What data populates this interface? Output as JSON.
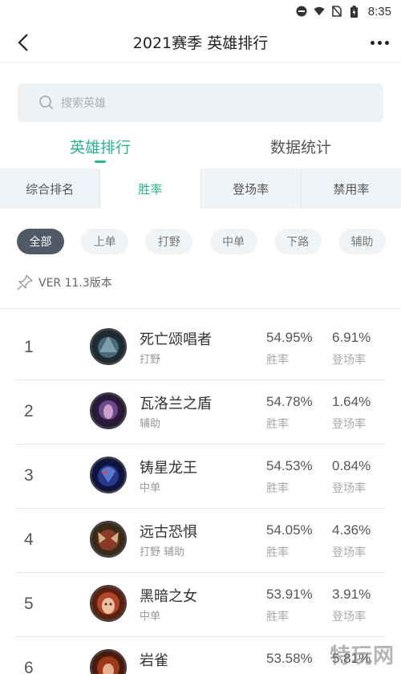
{
  "status_bar": {
    "time": "8:35"
  },
  "header": {
    "title": "2021赛季 英雄排行"
  },
  "search": {
    "placeholder": "搜索英雄"
  },
  "main_tabs": [
    {
      "label": "英雄排行",
      "active": true
    },
    {
      "label": "数据统计",
      "active": false
    }
  ],
  "sub_tabs": [
    {
      "label": "综合排名",
      "active": false
    },
    {
      "label": "胜率",
      "active": true
    },
    {
      "label": "登场率",
      "active": false
    },
    {
      "label": "禁用率",
      "active": false
    }
  ],
  "position_filters": [
    {
      "label": "全部",
      "active": true
    },
    {
      "label": "上单",
      "active": false
    },
    {
      "label": "打野",
      "active": false
    },
    {
      "label": "中单",
      "active": false
    },
    {
      "label": "下路",
      "active": false
    },
    {
      "label": "辅助",
      "active": false
    }
  ],
  "version": {
    "text": "VER 11.3版本"
  },
  "labels": {
    "win_rate": "胜率",
    "pick_rate": "登场率"
  },
  "heroes": [
    {
      "rank": "1",
      "name": "死亡颂唱者",
      "role": "打野",
      "win_rate": "54.95%",
      "pick_rate": "6.91%",
      "color": "#4a6a7a"
    },
    {
      "rank": "2",
      "name": "瓦洛兰之盾",
      "role": "辅助",
      "win_rate": "54.78%",
      "pick_rate": "1.64%",
      "color": "#6a4a8a"
    },
    {
      "rank": "3",
      "name": "铸星龙王",
      "role": "中单",
      "win_rate": "54.53%",
      "pick_rate": "0.84%",
      "color": "#2a3a8a"
    },
    {
      "rank": "4",
      "name": "远古恐惧",
      "role": "打野 辅助",
      "win_rate": "54.05%",
      "pick_rate": "4.36%",
      "color": "#8a3a2a"
    },
    {
      "rank": "5",
      "name": "黑暗之女",
      "role": "中单",
      "win_rate": "53.91%",
      "pick_rate": "3.91%",
      "color": "#b0452a"
    },
    {
      "rank": "6",
      "name": "岩雀",
      "role": "",
      "win_rate": "53.58%",
      "pick_rate": "5.81%",
      "color": "#9a3a1a"
    }
  ],
  "watermark": "特玩网",
  "colors": {
    "accent": "#2ab58f",
    "active_pill": "#4f5a66",
    "search_bg": "#eef2f5"
  }
}
